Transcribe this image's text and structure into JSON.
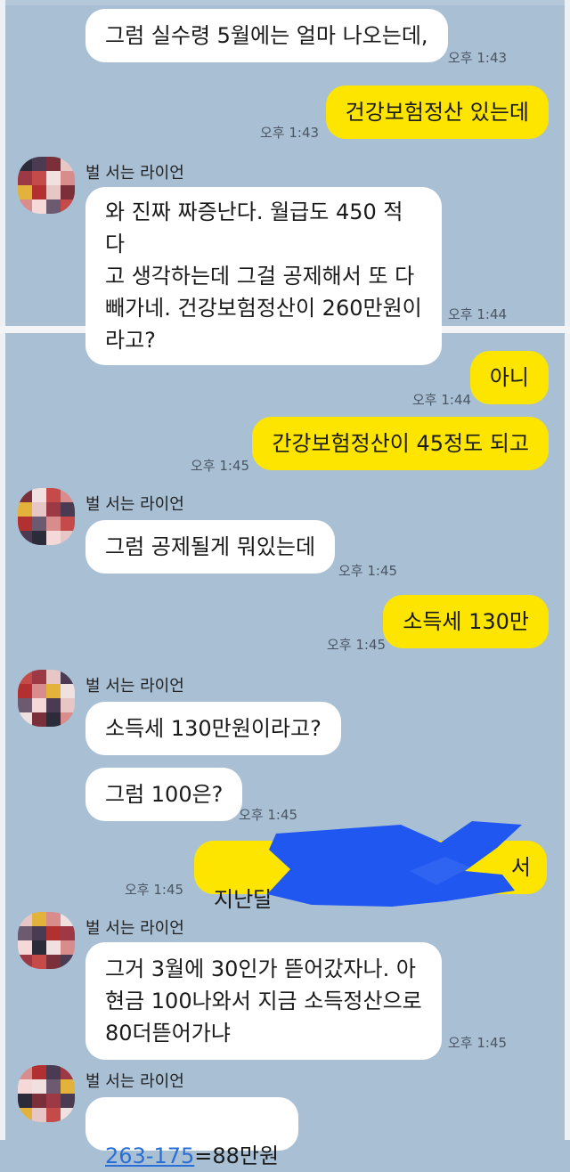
{
  "sender_name": "벌 서는 라이언",
  "messages": [
    {
      "text": "그럼 실수령 5월에는 얼마 나오는데,",
      "time": "오후 1:43"
    },
    {
      "text": "건강보험정산 있는데",
      "time": "오후 1:43"
    },
    {
      "text": "와 진짜 짜증난다. 월급도 450 적다\n고 생각하는데 그걸 공제해서 또 다\n빼가네. 건강보험정산이 260만원이\n라고?",
      "time": "오후 1:44"
    },
    {
      "text": "아니",
      "time": "오후 1:44"
    },
    {
      "text": "간강보험정산이 45정도 되고",
      "time": "오후 1:45"
    },
    {
      "text": "그럼 공제될게 뭐있는데",
      "time": "오후 1:45"
    },
    {
      "text": "소득세 130만",
      "time": "오후 1:45"
    },
    {
      "text": "소득세 130만원이라고?",
      "time": ""
    },
    {
      "text": "그럼 100은?",
      "time": "오후 1:45"
    },
    {
      "text_start": "지난달",
      "text_end": "서",
      "time": "오후 1:45"
    },
    {
      "text": "그거 3월에 30인가 뜯어갔자나. 아\n현금 100나와서 지금 소득정산으로\n80더뜯어가냐",
      "time": "오후 1:45"
    },
    {
      "link": "263-175",
      "text_rest": "=88만원",
      "time": ""
    }
  ],
  "colors": {
    "background": "#a9bfd4",
    "incoming_bubble": "#ffffff",
    "outgoing_bubble": "#fee500",
    "censor_mark": "#1f57f0",
    "link": "#2a6fd6"
  },
  "icons": {
    "avatar": "pixelated-avatar-image"
  }
}
